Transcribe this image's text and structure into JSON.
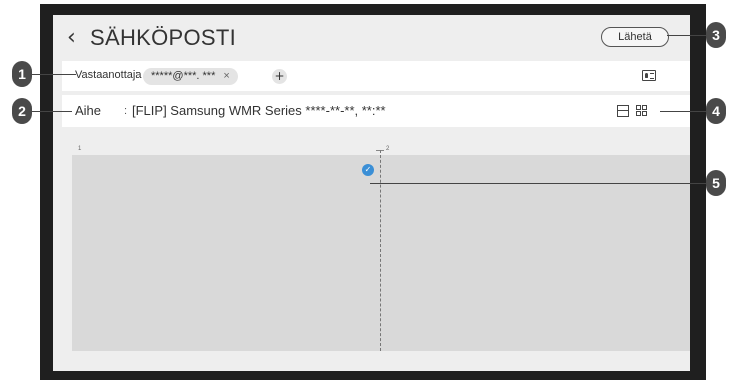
{
  "header": {
    "back_icon": "chevron-left-icon",
    "title": "SÄHKÖPOSTI",
    "send_label": "Lähetä"
  },
  "recipient": {
    "label": "Vastaanottaja",
    "colon": ":",
    "chip_text": "*****@***. ***",
    "chip_remove": "×",
    "add_label": "+",
    "contacts_icon": "contact-card-icon"
  },
  "subject": {
    "label": "Aihe",
    "colon": ":",
    "value": "[FLIP] Samsung WMR Series ****-**-**, **:**",
    "layout_icons": [
      "layout-single-icon",
      "layout-grid-icon"
    ]
  },
  "canvas": {
    "page_labels": [
      "1",
      "2"
    ],
    "selected_icon": "check-circle-icon"
  },
  "callouts": [
    "1",
    "2",
    "3",
    "4",
    "5"
  ]
}
